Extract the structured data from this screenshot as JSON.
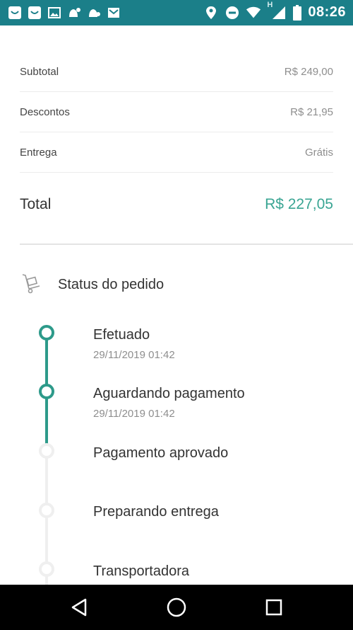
{
  "status_bar": {
    "time": "08:26",
    "network_label": "H",
    "left_icons": [
      "smile-icon",
      "smile-icon",
      "image-icon",
      "notification-icon",
      "notification-icon",
      "mail-icon"
    ],
    "right_icons": [
      "location-icon",
      "do-not-disturb-icon",
      "wifi-icon",
      "signal-icon",
      "battery-icon"
    ]
  },
  "summary": {
    "subtotal_label": "Subtotal",
    "subtotal_value": "R$ 249,00",
    "discount_label": "Descontos",
    "discount_value": "R$ 21,95",
    "delivery_label": "Entrega",
    "delivery_value": "Grátis",
    "total_label": "Total",
    "total_value": "R$ 227,05"
  },
  "order_status": {
    "title": "Status do pedido",
    "icon": "hand-truck-icon",
    "steps": [
      {
        "title": "Efetuado",
        "date": "29/11/2019 01:42",
        "state": "done"
      },
      {
        "title": "Aguardando pagamento",
        "date": "29/11/2019 01:42",
        "state": "done"
      },
      {
        "title": "Pagamento aprovado",
        "date": "",
        "state": "pending"
      },
      {
        "title": "Preparando entrega",
        "date": "",
        "state": "pending"
      },
      {
        "title": "Transportadora",
        "date": "",
        "state": "pending"
      }
    ]
  },
  "colors": {
    "status_bar": "#1b7f89",
    "accent": "#3aa593",
    "timeline_done": "#2d9a8a",
    "timeline_pending": "#efefef"
  },
  "nav": [
    "back-icon",
    "home-icon",
    "recents-icon"
  ]
}
